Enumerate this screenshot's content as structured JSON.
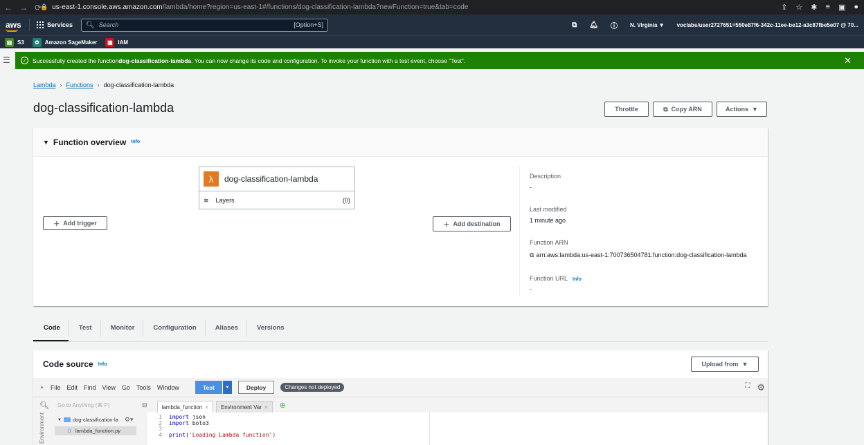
{
  "browser": {
    "url_domain": "us-east-1.console.aws.amazon.com",
    "url_path": "/lambda/home?region=us-east-1#/functions/dog-classification-lambda?newFunction=true&tab=code"
  },
  "nav": {
    "logo": "aws",
    "services": "Services",
    "search_placeholder": "Search",
    "search_shortcut": "[Option+S]",
    "region": "N. Virginia ▼",
    "account": "voclabs/user2727651=550e87f6-342c-11ee-be12-a3c87fbe5e07 @ 70..."
  },
  "favorites": [
    {
      "label": "S3",
      "color": "#3f8624"
    },
    {
      "label": "Amazon SageMaker",
      "color": "#1a7f74"
    },
    {
      "label": "IAM",
      "color": "#c7131f"
    }
  ],
  "flash": {
    "prefix": "Successfully created the function ",
    "fname": "dog-classification-lambda",
    "suffix": ". You can now change its code and configuration. To invoke your function with a test event, choose \"Test\"."
  },
  "breadcrumb": {
    "root": "Lambda",
    "mid": "Functions",
    "current": "dog-classification-lambda"
  },
  "page_title": "dog-classification-lambda",
  "header_buttons": {
    "throttle": "Throttle",
    "copy_arn": "Copy ARN",
    "actions": "Actions"
  },
  "overview": {
    "title": "Function overview",
    "info": "Info",
    "function_name": "dog-classification-lambda",
    "layers_label": "Layers",
    "layers_count": "(0)",
    "add_trigger": "Add trigger",
    "add_destination": "Add destination",
    "description_label": "Description",
    "description_value": "-",
    "last_modified_label": "Last modified",
    "last_modified_value": "1 minute ago",
    "arn_label": "Function ARN",
    "arn_value": "arn:aws:lambda:us-east-1:700736504781:function:dog-classification-lambda",
    "url_label": "Function URL",
    "url_info": "Info",
    "url_value": "-"
  },
  "tabs": [
    "Code",
    "Test",
    "Monitor",
    "Configuration",
    "Aliases",
    "Versions"
  ],
  "code_source": {
    "title": "Code source",
    "info": "Info",
    "upload": "Upload from",
    "menu": [
      "File",
      "Edit",
      "Find",
      "View",
      "Go",
      "Tools",
      "Window"
    ],
    "test": "Test",
    "deploy": "Deploy",
    "status": "Changes not deployed",
    "goto_placeholder": "Go to Anything (⌘ P)",
    "file_tab": "lambda_function",
    "env_tab": "Environment Var",
    "env_label": "Environment",
    "folder": "dog-classification-la",
    "file": "lambda_function.py",
    "lines": [
      {
        "n": "1",
        "kw": "import",
        "rest": " json"
      },
      {
        "n": "2",
        "kw": "import",
        "rest": " boto3"
      },
      {
        "n": "3",
        "kw": "",
        "rest": ""
      },
      {
        "n": "4",
        "kw": "print(",
        "rest": "'Loading Lambda function')"
      }
    ]
  }
}
